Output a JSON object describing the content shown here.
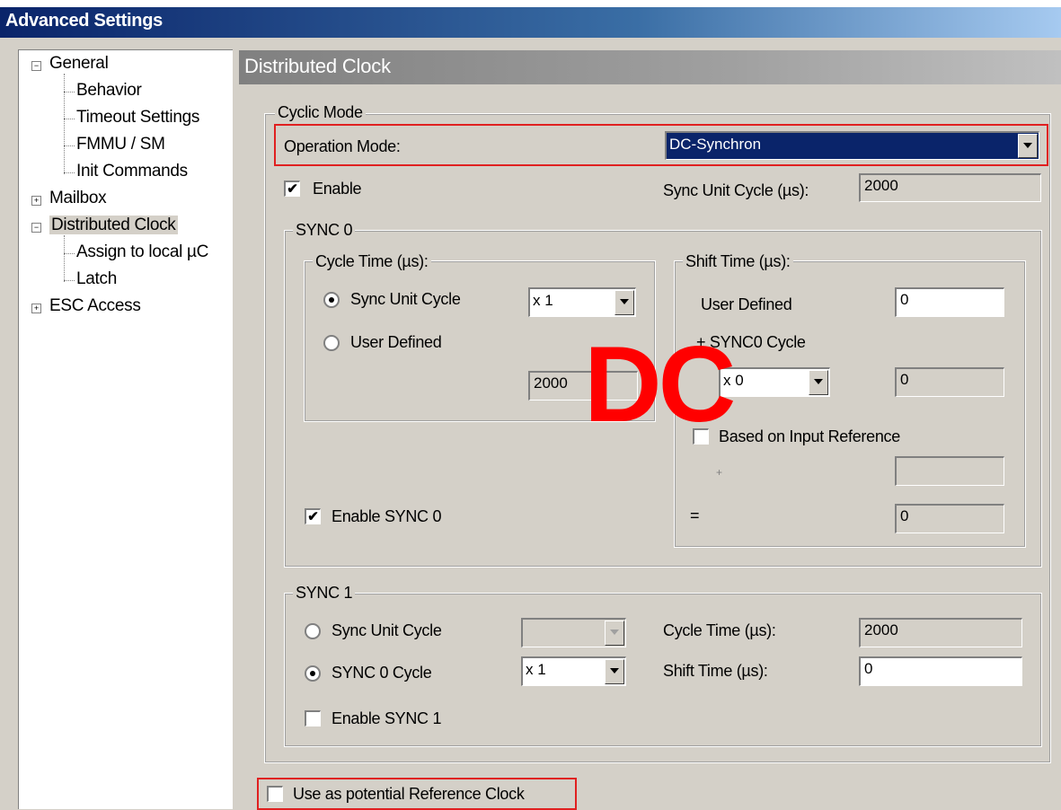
{
  "window": {
    "title": "Advanced Settings"
  },
  "tree": {
    "general": "General",
    "behavior": "Behavior",
    "timeout": "Timeout Settings",
    "fmmu": "FMMU / SM",
    "init": "Init Commands",
    "mailbox": "Mailbox",
    "dc": "Distributed Clock",
    "assign": "Assign to local µC",
    "latch": "Latch",
    "esc": "ESC Access"
  },
  "panel": {
    "title": "Distributed Clock"
  },
  "cyclic": {
    "group_label": "Cyclic Mode",
    "op_label": "Operation Mode:",
    "op_value": "DC-Synchron",
    "enable_label": "Enable",
    "sync_unit_label": "Sync Unit Cycle (µs):",
    "sync_unit_value": "2000"
  },
  "sync0": {
    "group_label": "SYNC 0",
    "cycle_group": "Cycle Time (µs):",
    "sync_unit_cycle": "Sync Unit Cycle",
    "multiplier": "x 1",
    "user_defined": "User Defined",
    "cycle_value": "2000",
    "shift_group": "Shift Time (µs):",
    "shift_user_label": "User Defined",
    "shift_user_value": "0",
    "plus_sync0_label": "+ SYNC0 Cycle",
    "sync0_mult": "x 0",
    "sync0_mult_value": "0",
    "based_label": "Based on Input Reference",
    "plus_sign": "+",
    "plus_value": "",
    "equals_sign": "=",
    "equals_value": "0",
    "enable_label": "Enable SYNC 0"
  },
  "sync1": {
    "group_label": "SYNC 1",
    "sync_unit_cycle": "Sync Unit Cycle",
    "sync0_cycle": "SYNC 0 Cycle",
    "multiplier": "x 1",
    "cycle_label": "Cycle Time (µs):",
    "cycle_value": "2000",
    "shift_label": "Shift Time (µs):",
    "shift_value": "0",
    "enable_label": "Enable SYNC 1"
  },
  "reference": {
    "label": "Use as potential Reference Clock"
  },
  "overlay": {
    "text": "DC",
    "color": "#ff0000"
  },
  "check": "✔"
}
